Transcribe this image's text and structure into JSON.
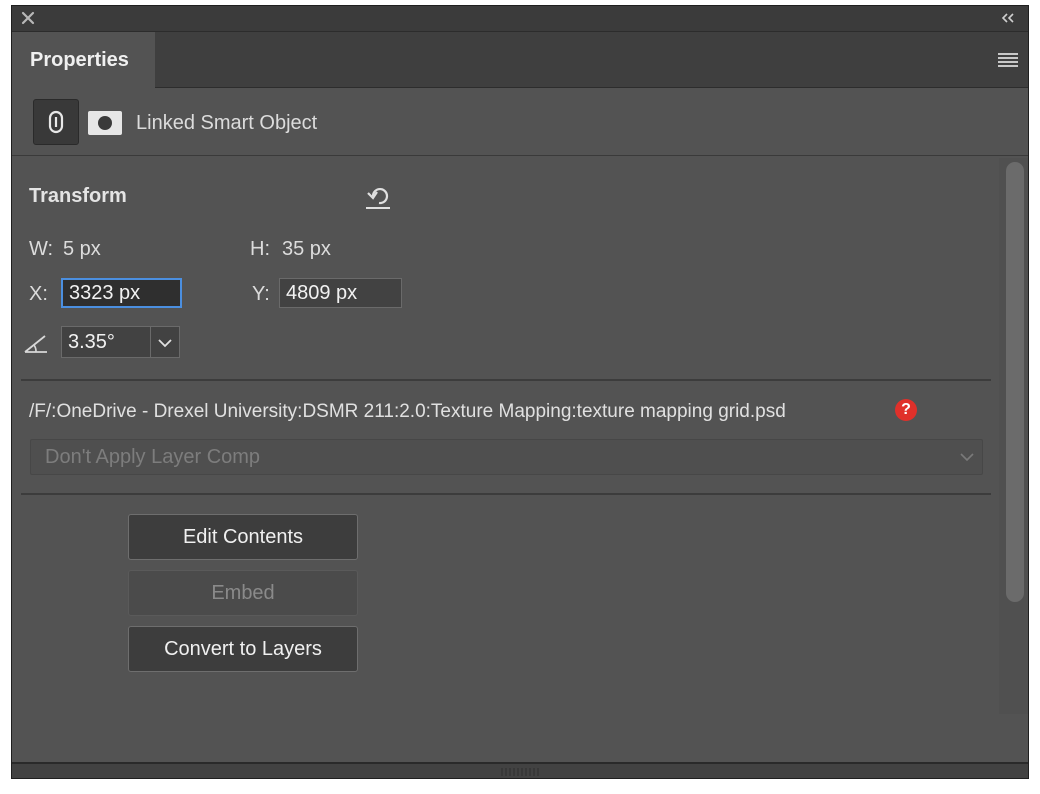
{
  "panel": {
    "tab_label": "Properties",
    "type_label": "Linked Smart Object"
  },
  "transform": {
    "title": "Transform",
    "w_label": "W:",
    "w_value": "5 px",
    "h_label": "H:",
    "h_value": "35 px",
    "x_label": "X:",
    "x_value": "3323 px",
    "y_label": "Y:",
    "y_value": "4809 px",
    "angle_value": "3.35°"
  },
  "source": {
    "path": "/F/:OneDrive - Drexel University:DSMR 211:2.0:Texture Mapping:texture mapping grid.psd",
    "missing_marker": "?",
    "layer_comp": "Don't Apply Layer Comp"
  },
  "actions": {
    "edit_contents": "Edit Contents",
    "embed": "Embed",
    "convert_to_layers": "Convert to Layers"
  },
  "colors": {
    "panel_bg": "#535353",
    "focus_ring": "#4b8fe0",
    "warning": "#e0302a"
  },
  "icons": [
    "close-icon",
    "collapse-icon",
    "panel-menu-icon",
    "link-icon",
    "mask-icon",
    "reset-icon",
    "angle-icon",
    "chevron-down-icon",
    "help-icon"
  ]
}
